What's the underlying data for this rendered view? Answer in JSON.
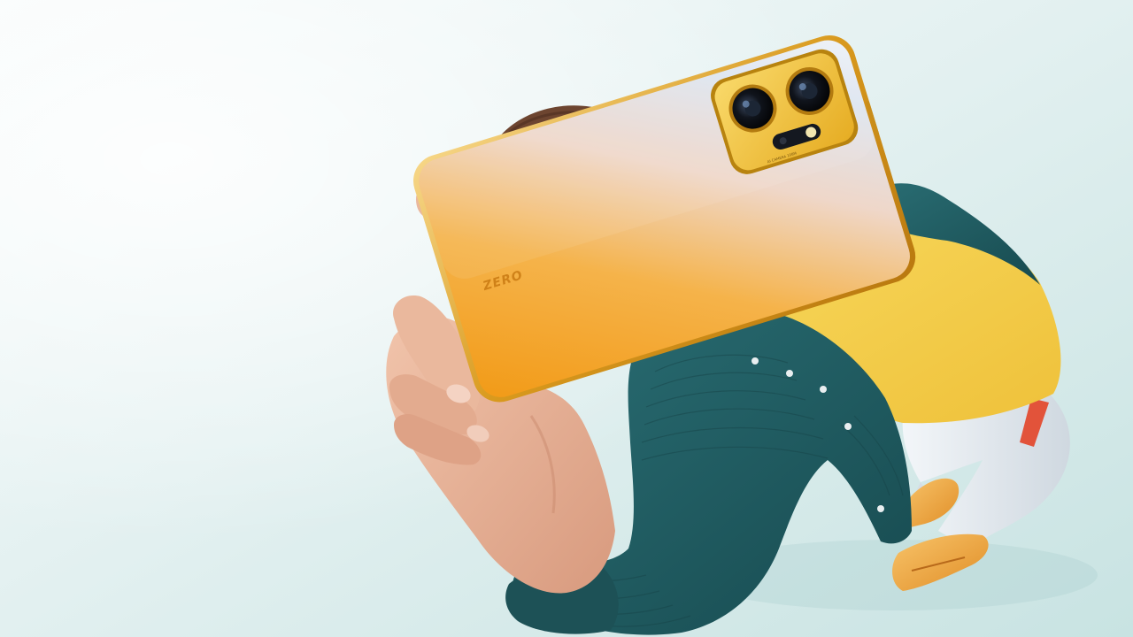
{
  "image": {
    "phone": {
      "brand_mark": "ZERO",
      "camera_module_text": "AI CAMERA 108M"
    }
  },
  "colors": {
    "background_light": "#f3f9f9",
    "background_mid": "#dceeee",
    "background_deep": "#c6e2e1",
    "phone_gold": "#f3a322",
    "phone_silver": "#dfe6ef",
    "phone_frame": "#d9a52a",
    "camera_module": "#f4c445",
    "shirt_teal": "#1f5a5f",
    "tshirt_yellow": "#f3cf4a",
    "pants_white": "#e8edf2",
    "shoes_orange": "#f2a94a",
    "hair_brown": "#6e4630",
    "skin": "#e7b49a"
  }
}
